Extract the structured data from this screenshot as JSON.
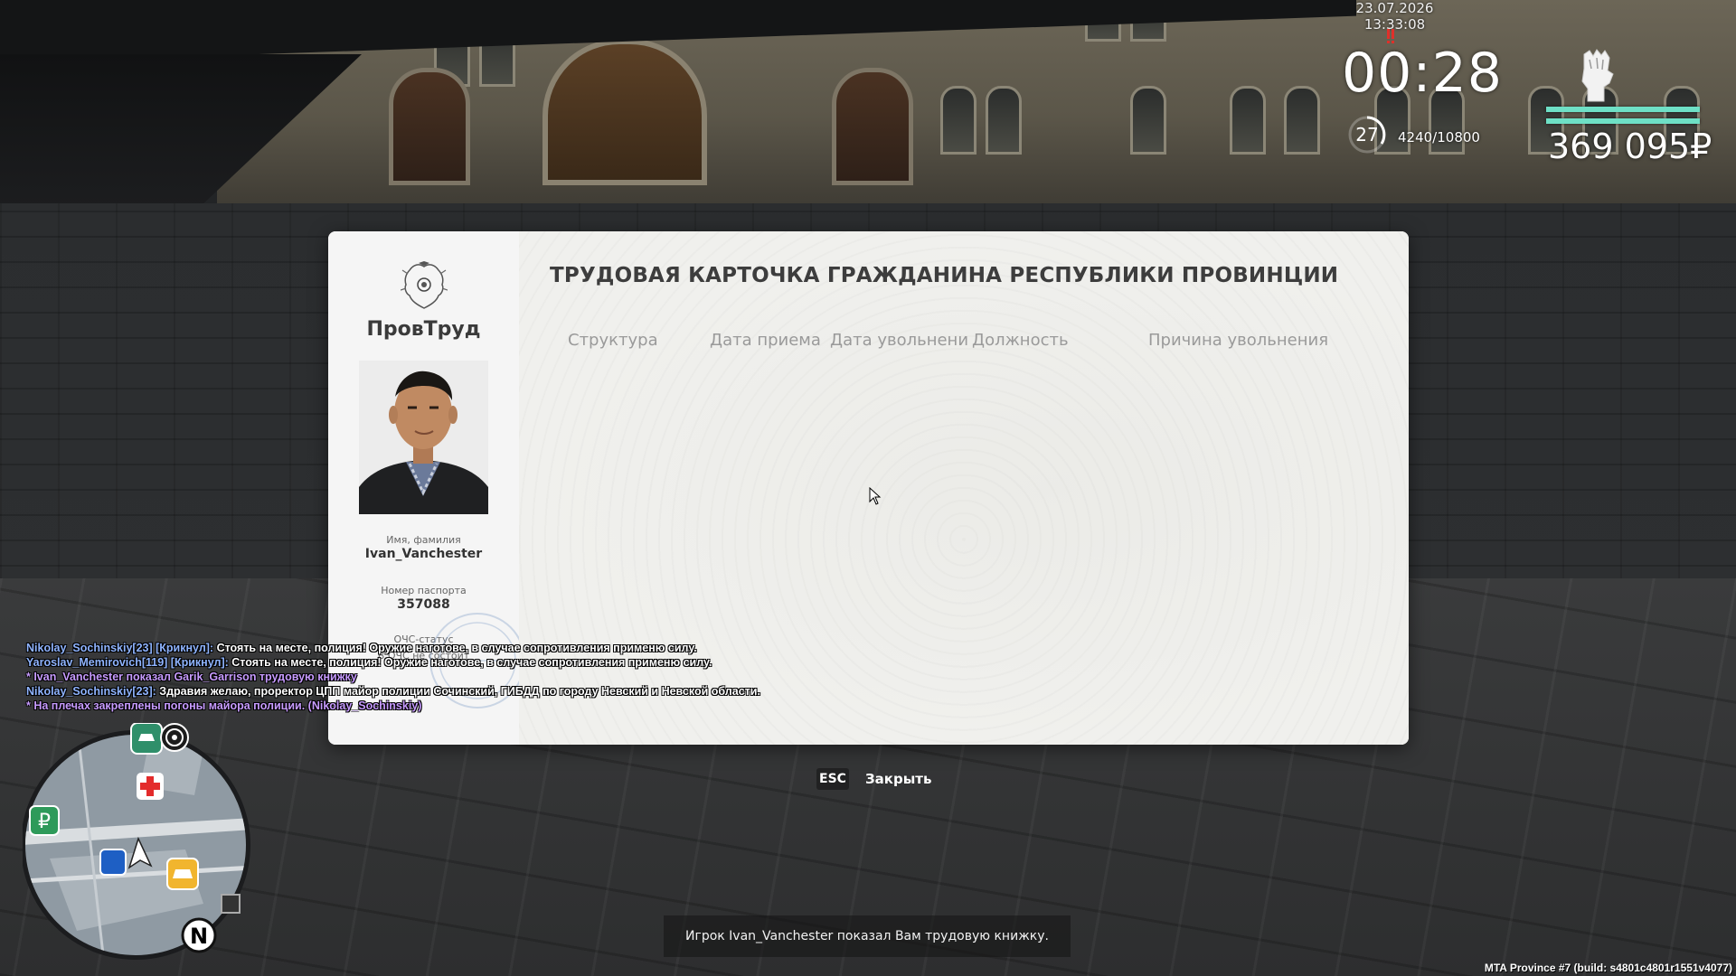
{
  "hud": {
    "datetime": "23.07.2026 13:33:08",
    "timer": "00:28",
    "level": "27",
    "xp": "4240/10800",
    "money": "369 095₽",
    "accent": "#6ee0c6"
  },
  "card": {
    "brand": "ПровТруд",
    "title": "ТРУДОВАЯ КАРТОЧКА ГРАЖДАНИНА РЕСПУБЛИКИ ПРОВИНЦИИ",
    "name_label": "Имя, фамилия",
    "name_value": "Ivan_Vanchester",
    "passport_label": "Номер паспорта",
    "passport_value": "357088",
    "ochs_label": "ОЧС-статус",
    "ochs_value": "В ОЧС не состоит",
    "columns": [
      "Структура",
      "Дата приема",
      "Дата увольнени",
      "Должность",
      "Причина увольнения"
    ]
  },
  "close": {
    "key": "ESC",
    "label": "Закрыть"
  },
  "chat": [
    {
      "name": "Nikolay_Sochinskiy[23] [Крикнул]:",
      "text": " Стоять на месте, полиция! Оружие наготове, в случае сопротивления применю силу.",
      "kind": "say"
    },
    {
      "name": "Yaroslav_Memirovich[119] [Крикнул]:",
      "text": " Стоять на месте, полиция! Оружие наготове, в случае сопротивления применю силу.",
      "kind": "say"
    },
    {
      "name": "",
      "text": "* Ivan_Vanchester показал Garik_Garrison трудовую книжку",
      "kind": "me"
    },
    {
      "name": "Nikolay_Sochinskiy[23]:",
      "text": " Здравия желаю, проректор ЦПП майор полиции Сочинский, ГИБДД по городу Невский и Невской области.",
      "kind": "say"
    },
    {
      "name": "",
      "text": "* На плечах закреплены погоны майора полиции. (Nikolay_Sochinskiy)",
      "kind": "me"
    }
  ],
  "notification": "Игрок Ivan_Vanchester показал Вам трудовую книжку.",
  "build": "MTA Province #7 (build: s4801c4801r1551v4077)",
  "minimap": {
    "north": "N"
  }
}
